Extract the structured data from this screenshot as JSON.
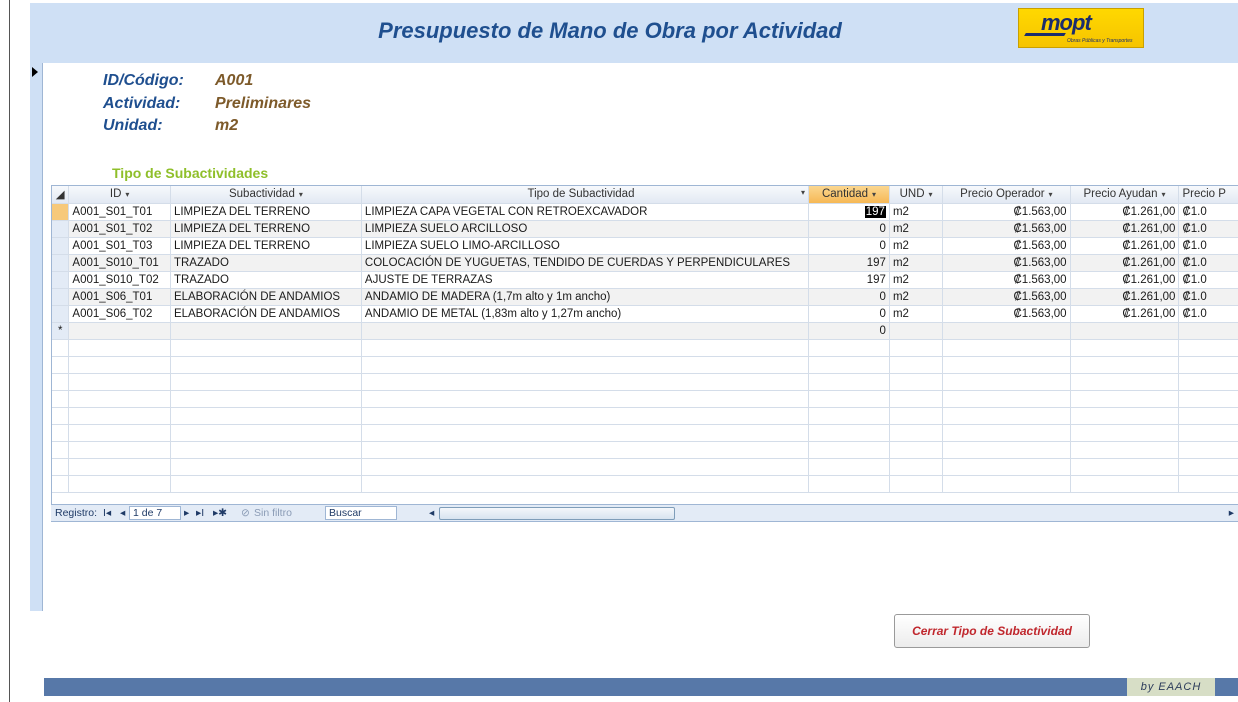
{
  "header": {
    "title": "Presupuesto de Mano de Obra por Actividad",
    "logo_text": "mopt",
    "logo_subtext": "Obras Públicas y Transportes"
  },
  "info": {
    "id_label": "ID/Código:",
    "id_value": "A001",
    "actividad_label": "Actividad:",
    "actividad_value": "Preliminares",
    "unidad_label": "Unidad:",
    "unidad_value": "m2"
  },
  "subtitle": "Tipo de  Subactividades",
  "table": {
    "columns": [
      "ID",
      "Subactividad",
      "Tipo de Subactividad",
      "Cantidad",
      "UND",
      "Precio Operador",
      "Precio Ayudan",
      "Precio P"
    ],
    "rows": [
      [
        "A001_S01_T01",
        "LIMPIEZA DEL TERRENO",
        "LIMPIEZA CAPA VEGETAL CON RETROEXCAVADOR",
        "197",
        "m2",
        "₡1.563,00",
        "₡1.261,00",
        "₡1.0"
      ],
      [
        "A001_S01_T02",
        "LIMPIEZA DEL TERRENO",
        "LIMPIEZA SUELO ARCILLOSO",
        "0",
        "m2",
        "₡1.563,00",
        "₡1.261,00",
        "₡1.0"
      ],
      [
        "A001_S01_T03",
        "LIMPIEZA DEL TERRENO",
        "LIMPIEZA SUELO LIMO-ARCILLOSO",
        "0",
        "m2",
        "₡1.563,00",
        "₡1.261,00",
        "₡1.0"
      ],
      [
        "A001_S010_T01",
        "TRAZADO",
        "COLOCACIÓN DE YUGUETAS, TENDIDO DE CUERDAS Y PERPENDICULARES",
        "197",
        "m2",
        "₡1.563,00",
        "₡1.261,00",
        "₡1.0"
      ],
      [
        "A001_S010_T02",
        "TRAZADO",
        "AJUSTE DE TERRAZAS",
        "197",
        "m2",
        "₡1.563,00",
        "₡1.261,00",
        "₡1.0"
      ],
      [
        "A001_S06_T01",
        "ELABORACIÓN DE ANDAMIOS",
        "ANDAMIO DE MADERA (1,7m alto y 1m ancho)",
        "0",
        "m2",
        "₡1.563,00",
        "₡1.261,00",
        "₡1.0"
      ],
      [
        "A001_S06_T02",
        "ELABORACIÓN DE ANDAMIOS",
        "ANDAMIO DE METAL (1,83m alto y 1,27m ancho)",
        "0",
        "m2",
        "₡1.563,00",
        "₡1.261,00",
        "₡1.0"
      ]
    ],
    "new_row_marker": "*",
    "new_row_cantidad": "0"
  },
  "navigation": {
    "registro_label": "Registro:",
    "first_glyph": "I◂",
    "prev_glyph": "◂",
    "position": "1 de 7",
    "next_glyph": "▸",
    "last_glyph": "▸I",
    "new_glyph": "▸✱",
    "filter_label": "Sin filtro",
    "search_label": "Buscar"
  },
  "button": {
    "close_label": "Cerrar Tipo de Subactividad"
  },
  "footer": {
    "signature": "by EAACH"
  }
}
